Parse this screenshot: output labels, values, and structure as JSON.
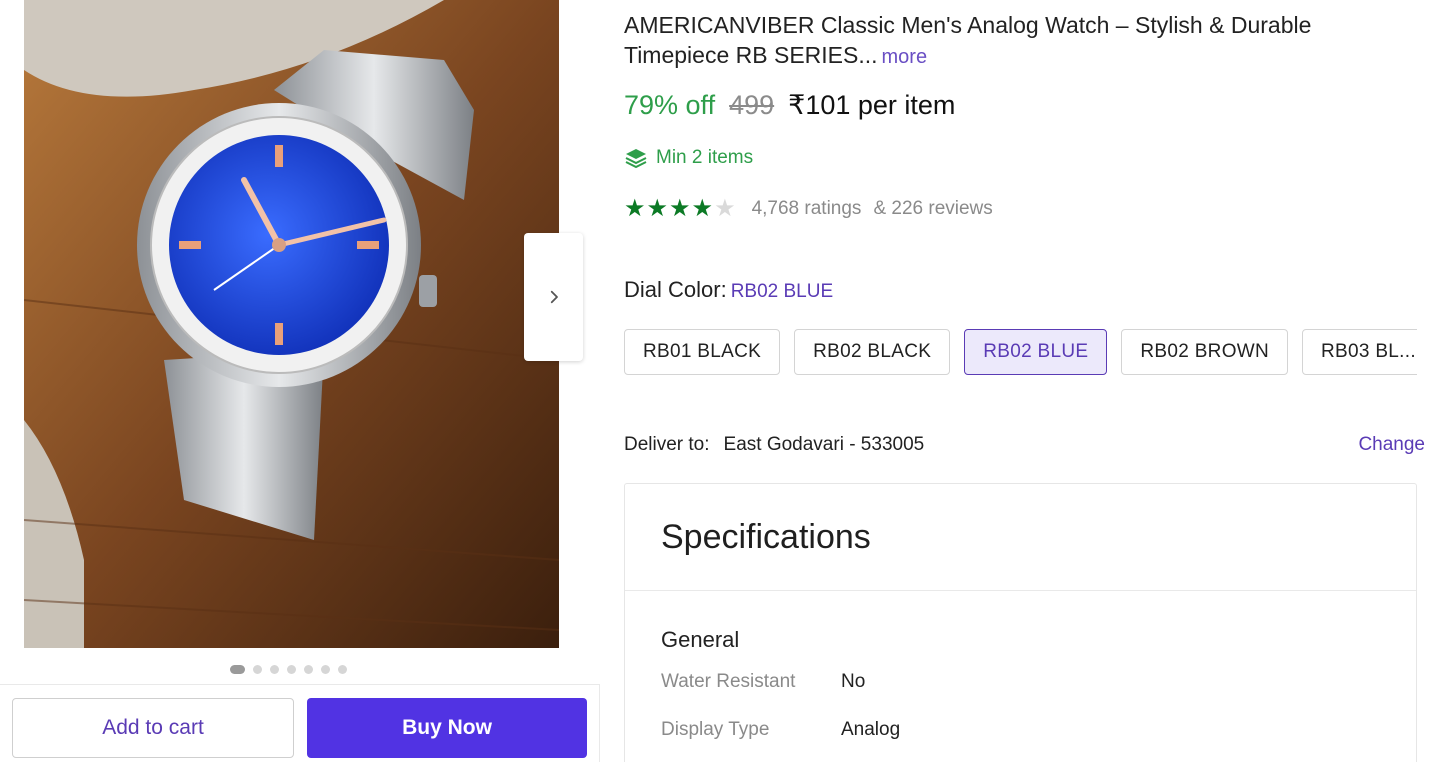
{
  "product": {
    "title": "AMERICANVIBER Classic Men's Analog Watch – Stylish & Durable Timepiece RB SERIES...",
    "more_label": "more",
    "discount": "79% off",
    "mrp": "499",
    "price": "₹101 per item",
    "min_items": "Min 2 items",
    "rating_stars": 4,
    "ratings_text": "4,768 ratings",
    "reviews_text": "& 226 reviews"
  },
  "gallery": {
    "image_count": 7,
    "active_index": 0
  },
  "variants": {
    "label": "Dial Color:",
    "selected": "RB02 BLUE",
    "options": [
      "RB01 BLACK",
      "RB02 BLACK",
      "RB02 BLUE",
      "RB02 BROWN",
      "RB03 BL..."
    ]
  },
  "delivery": {
    "label": "Deliver to:",
    "location": "East Godavari - 533005",
    "change_label": "Change"
  },
  "specifications": {
    "title": "Specifications",
    "group": "General",
    "rows": [
      {
        "key": "Water Resistant",
        "value": "No"
      },
      {
        "key": "Display Type",
        "value": "Analog"
      }
    ]
  },
  "actions": {
    "add_to_cart": "Add to cart",
    "buy_now": "Buy Now"
  },
  "colors": {
    "accent": "#5133e3",
    "link": "#5a3bb5",
    "discount": "#2e9e4a",
    "star": "#0c7a25",
    "dial": "#1f3fd6"
  }
}
